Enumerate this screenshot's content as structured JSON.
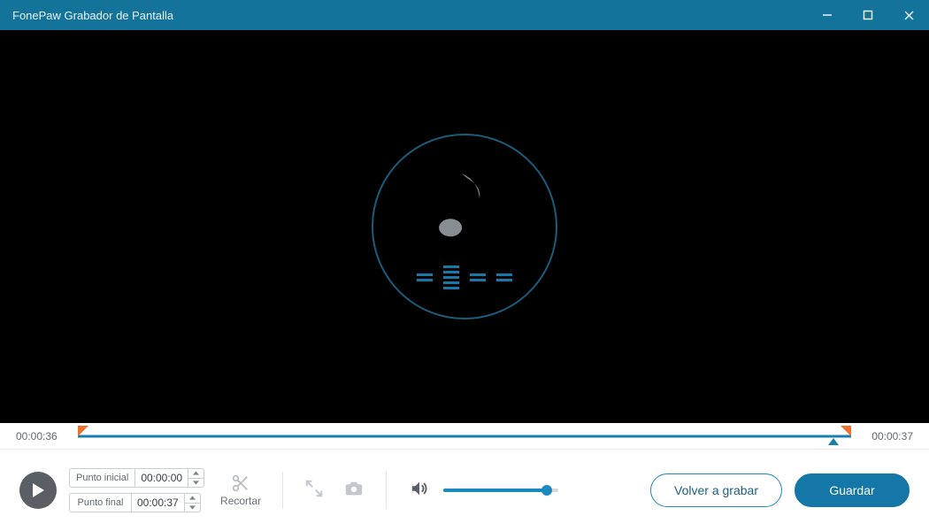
{
  "window": {
    "title": "FonePaw Grabador de Pantalla"
  },
  "timeline": {
    "current": "00:00:36",
    "total": "00:00:37"
  },
  "trim": {
    "start_label": "Punto inicial",
    "start_value": "00:00:00",
    "end_label": "Punto final",
    "end_value": "00:00:37",
    "cut_label": "Recortar"
  },
  "buttons": {
    "rerecord": "Volver a grabar",
    "save": "Guardar"
  },
  "colors": {
    "accent": "#1a8ac0",
    "titlebar": "#14739b",
    "marker": "#ed7232"
  }
}
